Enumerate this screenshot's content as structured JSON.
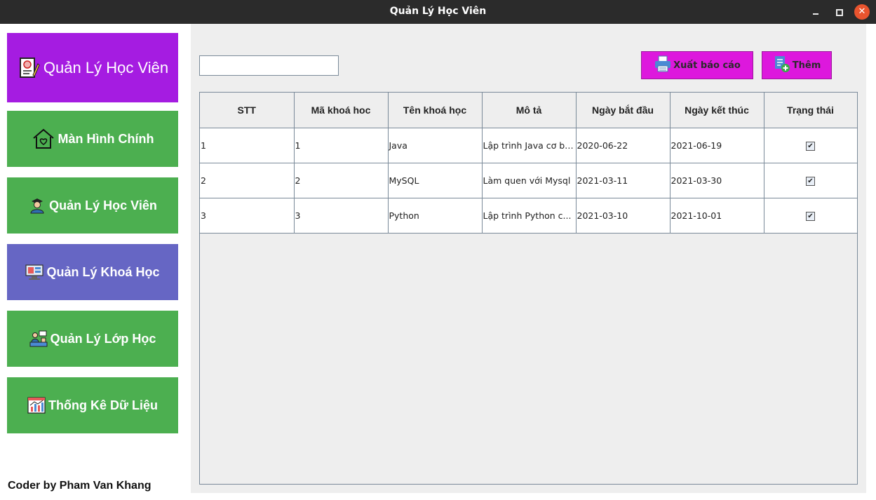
{
  "window": {
    "title": "Quản Lý Học Viên"
  },
  "sidebar": {
    "header": {
      "label": "Quản Lý Học Viên",
      "icon": "certificate-icon",
      "color": "#a51ce1"
    },
    "items": [
      {
        "label": "Màn Hình Chính",
        "icon": "home-icon"
      },
      {
        "label": "Quản Lý Học Viên",
        "icon": "student-icon"
      },
      {
        "label": "Quản Lý Khoá Học",
        "icon": "course-icon",
        "active": true
      },
      {
        "label": "Quản Lý Lớp Học",
        "icon": "classroom-icon"
      },
      {
        "label": "Thống Kê Dữ Liệu",
        "icon": "statistics-icon"
      }
    ],
    "item_color": "#4caf50",
    "active_color": "#6666c4",
    "footer": "Coder by Pham Van Khang"
  },
  "toolbar": {
    "search_value": "",
    "export_label": "Xuất báo cáo",
    "add_label": "Thêm",
    "button_color": "#dd18dd"
  },
  "table": {
    "columns": [
      "STT",
      "Mã khoá hoc",
      "Tên khoá học",
      "Mô tả",
      "Ngày bắt đầu",
      "Ngày kết thúc",
      "Trạng thái"
    ],
    "rows": [
      {
        "stt": "1",
        "ma": "1",
        "ten": "Java",
        "mota": "Lập trình Java cơ bản",
        "batdau": "2020-06-22",
        "ketthuc": "2021-06-19",
        "trangthai": true
      },
      {
        "stt": "2",
        "ma": "2",
        "ten": "MySQL",
        "mota": "Làm quen với Mysql",
        "batdau": "2021-03-11",
        "ketthuc": "2021-03-30",
        "trangthai": true
      },
      {
        "stt": "3",
        "ma": "3",
        "ten": "Python",
        "mota": "Lập trình Python c...",
        "batdau": "2021-03-10",
        "ketthuc": "2021-10-01",
        "trangthai": true
      }
    ]
  }
}
